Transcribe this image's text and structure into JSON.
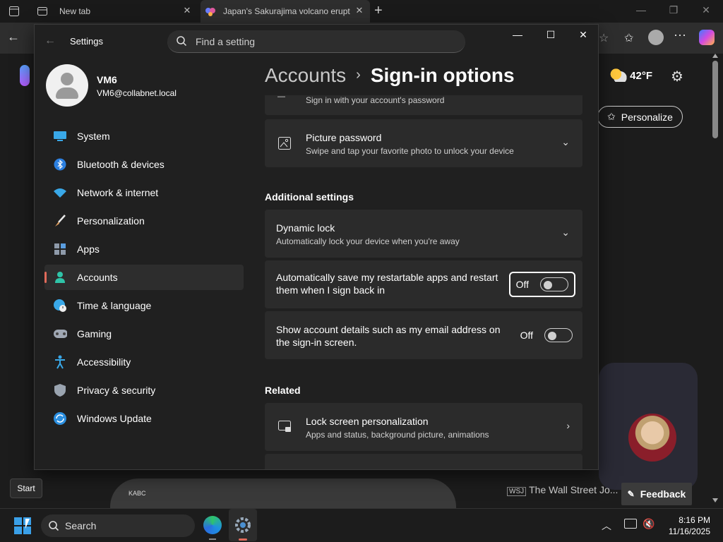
{
  "browser": {
    "tabs": [
      {
        "title": "New tab"
      },
      {
        "title": "Japan's Sakurajima volcano erupt"
      }
    ],
    "weather": {
      "temp": "42°F"
    },
    "personalize_label": "Personalize",
    "feedback_label": "Feedback",
    "news_source": "The Wall Street Jo...",
    "news_thumb_label": "KABC"
  },
  "settings": {
    "app_title": "Settings",
    "search_placeholder": "Find a setting",
    "profile": {
      "name": "VM6",
      "email": "VM6@collabnet.local"
    },
    "nav": [
      {
        "label": "System",
        "icon": "monitor-icon"
      },
      {
        "label": "Bluetooth & devices",
        "icon": "bluetooth-icon"
      },
      {
        "label": "Network & internet",
        "icon": "wifi-icon"
      },
      {
        "label": "Personalization",
        "icon": "brush-icon"
      },
      {
        "label": "Apps",
        "icon": "apps-icon"
      },
      {
        "label": "Accounts",
        "icon": "person-icon",
        "selected": true
      },
      {
        "label": "Time & language",
        "icon": "globe-clock-icon"
      },
      {
        "label": "Gaming",
        "icon": "gamepad-icon"
      },
      {
        "label": "Accessibility",
        "icon": "accessibility-icon"
      },
      {
        "label": "Privacy & security",
        "icon": "shield-icon"
      },
      {
        "label": "Windows Update",
        "icon": "update-icon"
      }
    ],
    "breadcrumb": {
      "parent": "Accounts",
      "separator": "›",
      "current": "Sign-in options"
    },
    "cards": {
      "password_desc_partial": "Sign in with your account's password",
      "picture_password": {
        "title": "Picture password",
        "desc": "Swipe and tap your favorite photo to unlock your device"
      },
      "additional_heading": "Additional settings",
      "dynamic_lock": {
        "title": "Dynamic lock",
        "desc": "Automatically lock your device when you're away"
      },
      "restart_apps": {
        "title_line1": "Automatically save my restartable apps and restart",
        "title_line2": "them when I sign back in",
        "state": "Off"
      },
      "account_details": {
        "title_line1": "Show account details such as my email address on",
        "title_line2": "the sign-in screen.",
        "state": "Off"
      },
      "related_heading": "Related",
      "lock_screen": {
        "title": "Lock screen personalization",
        "desc": "Apps and status, background picture, animations"
      }
    }
  },
  "taskbar": {
    "search_label": "Search",
    "start_tooltip": "Start",
    "time": "8:16 PM",
    "date": "11/16/2025"
  },
  "colors": {
    "accent": "#e06a5a",
    "card": "#2b2b2b",
    "window": "#202020"
  }
}
